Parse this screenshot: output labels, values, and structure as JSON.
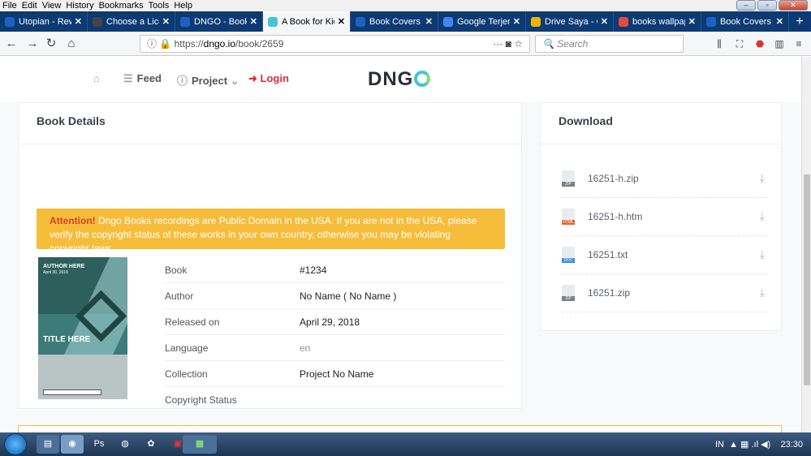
{
  "menubar": [
    "File",
    "Edit",
    "View",
    "History",
    "Bookmarks",
    "Tools",
    "Help"
  ],
  "tabs": [
    {
      "label": "Utopian - Rewar",
      "icon_color": "#1c62c4",
      "active": false
    },
    {
      "label": "Choose a Licens",
      "icon_color": "#444444",
      "active": false
    },
    {
      "label": "DNGO - Book Co",
      "icon_color": "#1c62c4",
      "active": false
    },
    {
      "label": "A Book for Kids",
      "icon_color": "#42c5d6",
      "active": true
    },
    {
      "label": "Book Covers De",
      "icon_color": "#1c62c4",
      "active": false
    },
    {
      "label": "Google Terjemah",
      "icon_color": "#4285f4",
      "active": false
    },
    {
      "label": "Drive Saya - Goo",
      "icon_color": "#f2b400",
      "active": false
    },
    {
      "label": "books wallpape",
      "icon_color": "#e04b3a",
      "active": false
    },
    {
      "label": "Book Covers De",
      "icon_color": "#1c62c4",
      "active": false
    }
  ],
  "url": {
    "prefix": "https://",
    "host": "dngo.io",
    "path": "/book/2659"
  },
  "search_placeholder": "Search",
  "site": {
    "nav": {
      "feed": "Feed",
      "project": "Project",
      "login": "Login"
    },
    "logo": "DNG"
  },
  "details": {
    "title": "Book Details",
    "alert_strong": "Attention!",
    "alert_text": " Dngo Books recordings are Public Domain in the USA. If you are not in the USA, please verify the copyright status of these works in your own country, otherwise you may be violating copyright laws.",
    "cover": {
      "top": "AUTHOR HERE",
      "date": "April 30, 2018",
      "title": "TITLE HERE"
    },
    "rows": [
      {
        "key": "Book",
        "value": "#1234"
      },
      {
        "key": "Author",
        "value": "No Name ( No Name )"
      },
      {
        "key": "Released on",
        "value": "April 29, 2018"
      },
      {
        "key": "Language",
        "value": "en"
      },
      {
        "key": "Collection",
        "value": "Project No Name"
      },
      {
        "key": "Copyright Status",
        "value": ""
      }
    ]
  },
  "download": {
    "title": "Download",
    "files": [
      {
        "name": "16251-h.zip",
        "tag": "ZIP",
        "tag_color": "#7b7f86"
      },
      {
        "name": "16251-h.htm",
        "tag": "HTML",
        "tag_color": "#e2662c"
      },
      {
        "name": "16251.txt",
        "tag": "DOC",
        "tag_color": "#3a8ee6"
      },
      {
        "name": "16251.zip",
        "tag": "ZIP",
        "tag_color": "#7b7f86"
      }
    ]
  },
  "tray": {
    "lang": "IN",
    "time": "23:30"
  }
}
